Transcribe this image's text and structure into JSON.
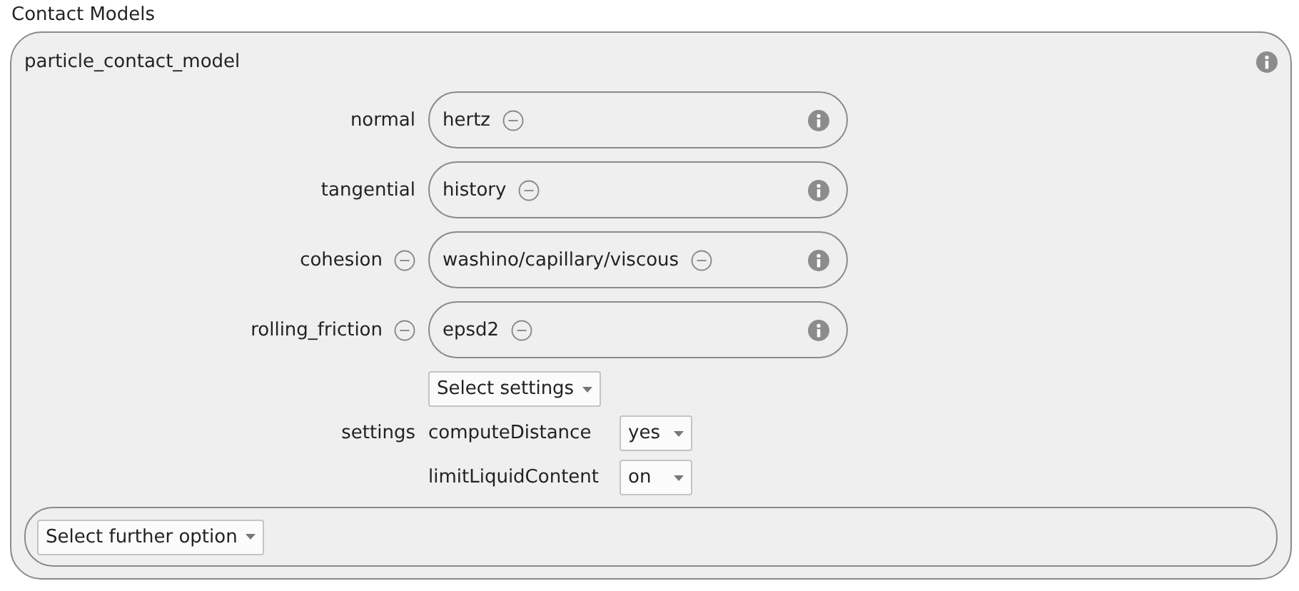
{
  "title": "Contact Models",
  "group": {
    "name": "particle_contact_model",
    "rows": [
      {
        "label": "normal",
        "removable": false,
        "value": "hertz"
      },
      {
        "label": "tangential",
        "removable": false,
        "value": "history"
      },
      {
        "label": "cohesion",
        "removable": true,
        "value": "washino/capillary/viscous"
      },
      {
        "label": "rolling_friction",
        "removable": true,
        "value": "epsd2"
      }
    ],
    "settings": {
      "label": "settings",
      "select": "Select settings",
      "options": [
        {
          "name": "computeDistance",
          "value": "yes"
        },
        {
          "name": "limitLiquidContent",
          "value": "on"
        }
      ]
    },
    "further": "Select further option"
  }
}
